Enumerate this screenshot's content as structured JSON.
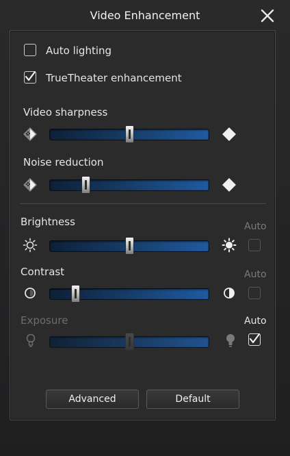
{
  "window": {
    "title": "Video Enhancement"
  },
  "options": {
    "auto_lighting": {
      "label": "Auto lighting",
      "checked": false
    },
    "truetheater": {
      "label": "TrueTheater enhancement",
      "checked": true
    }
  },
  "sliders": {
    "video_sharpness": {
      "label": "Video sharpness",
      "value": 0.5
    },
    "noise_reduction": {
      "label": "Noise reduction",
      "value": 0.21
    },
    "brightness": {
      "label": "Brightness",
      "value": 0.5,
      "auto_label": "Auto",
      "auto_checked": false
    },
    "contrast": {
      "label": "Contrast",
      "value": 0.14,
      "auto_label": "Auto",
      "auto_checked": false
    },
    "exposure": {
      "label": "Exposure",
      "value": 0.5,
      "auto_label": "Auto",
      "auto_checked": true,
      "disabled": true
    }
  },
  "buttons": {
    "advanced": "Advanced",
    "default": "Default"
  },
  "colors": {
    "accent": "#1f5aa0",
    "panel": "#2b2b2c",
    "text": "#e6e6e6",
    "disabled_text": "#6d6d6d"
  }
}
